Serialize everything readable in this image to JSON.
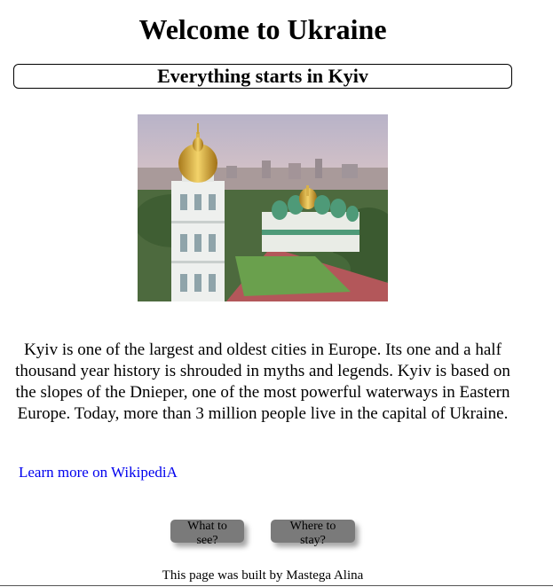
{
  "header": {
    "title": "Welcome to Ukraine",
    "subtitle": "Everything starts in Kyiv"
  },
  "main": {
    "photo_alt": "Saint Sophia Cathedral bell tower and golden domes overlooking Kyiv",
    "intro_text": "Kyiv is one of the largest and oldest cities in Europe. Its one and a half thousand year history is shrouded in myths and legends. Kyiv is based on the slopes of the Dnieper, one of the most powerful waterways in Eastern Europe. Today, more than 3 million people live in the capital of Ukraine.",
    "wiki_link_label": "Learn more on WikipediA"
  },
  "buttons": {
    "see_label": "What to see?",
    "stay_label": "Where to stay?",
    "color": "#7a7a7a"
  },
  "footer": {
    "text": "This page was built by Mastega Alina"
  },
  "colors": {
    "link": "#0000ee",
    "background": "#ffffff"
  }
}
